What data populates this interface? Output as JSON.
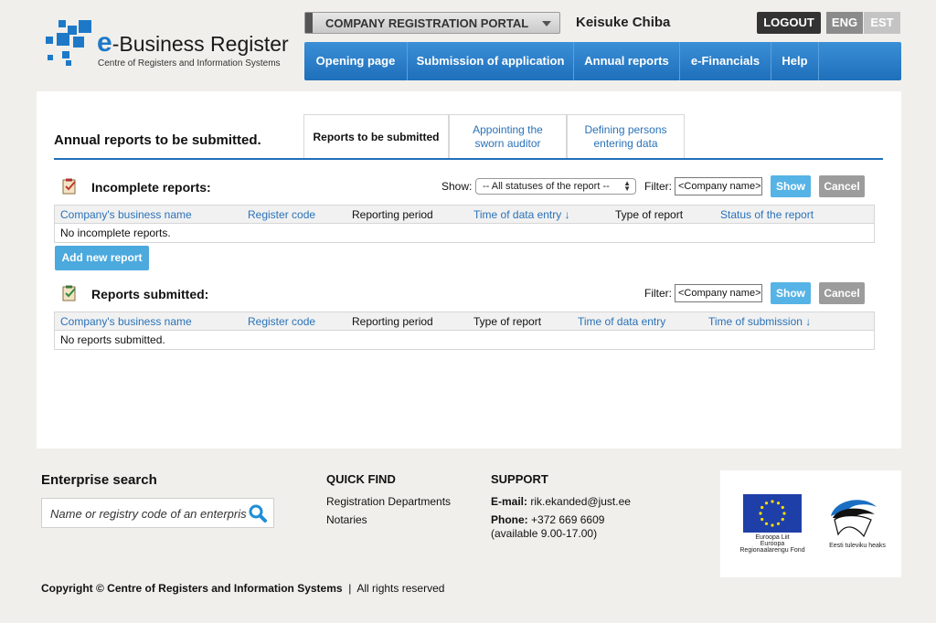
{
  "header": {
    "logo_title": "e-Business Register",
    "logo_subtitle": "Centre of Registers and Information Systems",
    "portal_label": "COMPANY REGISTRATION PORTAL",
    "user_name": "Keisuke Chiba",
    "logout_label": "LOGOUT",
    "languages": [
      "ENG",
      "EST"
    ]
  },
  "nav": {
    "items": [
      "Opening page",
      "Submission of application",
      "Annual reports",
      "e-Financials",
      "Help"
    ]
  },
  "main": {
    "page_title": "Annual reports to be submitted.",
    "tabs": [
      {
        "label": "Reports to be submitted"
      },
      {
        "label": "Appointing the sworn auditor"
      },
      {
        "label": "Defining persons entering data"
      }
    ],
    "incomplete": {
      "title": "Incomplete reports:",
      "show_label": "Show:",
      "status_select": "-- All statuses of the report --",
      "filter_label": "Filter:",
      "filter_value": "<Company name>",
      "show_button": "Show",
      "cancel_button": "Cancel",
      "columns": [
        "Company's business name",
        "Register code",
        "Reporting period",
        "Time of data entry ↓",
        "Type of report",
        "Status of the report"
      ],
      "empty_text": "No incomplete reports.",
      "add_button": "Add new report"
    },
    "submitted": {
      "title": "Reports submitted:",
      "filter_label": "Filter:",
      "filter_value": "<Company name>",
      "show_button": "Show",
      "cancel_button": "Cancel",
      "columns": [
        "Company's business name",
        "Register code",
        "Reporting period",
        "Type of report",
        "Time of data entry",
        "Time of submission ↓"
      ],
      "empty_text": "No reports submitted."
    }
  },
  "footer": {
    "search_title": "Enterprise search",
    "search_placeholder": "Name or registry code of an enterprise",
    "quick_find_title": "QUICK FIND",
    "quick_find_links": [
      "Registration Departments",
      "Notaries"
    ],
    "support_title": "SUPPORT",
    "email_label": "E-mail:",
    "email_value": "rik.ekanded@just.ee",
    "phone_label": "Phone:",
    "phone_value": "+372 669 6609",
    "hours": "(available 9.00-17.00)",
    "eu_caption": "Euroopa Liit\nEuroopa\nRegionaalarengu Fond",
    "estonia_caption": "Eesti tuleviku heaks",
    "copyright": "Copyright © Centre of Registers and Information Systems",
    "rights": "All rights reserved"
  },
  "colors": {
    "nav_blue": "#1f6fbb",
    "link_blue": "#2a72b8",
    "show_button": "#56b3e6",
    "cancel_button": "#9c9c9c"
  }
}
